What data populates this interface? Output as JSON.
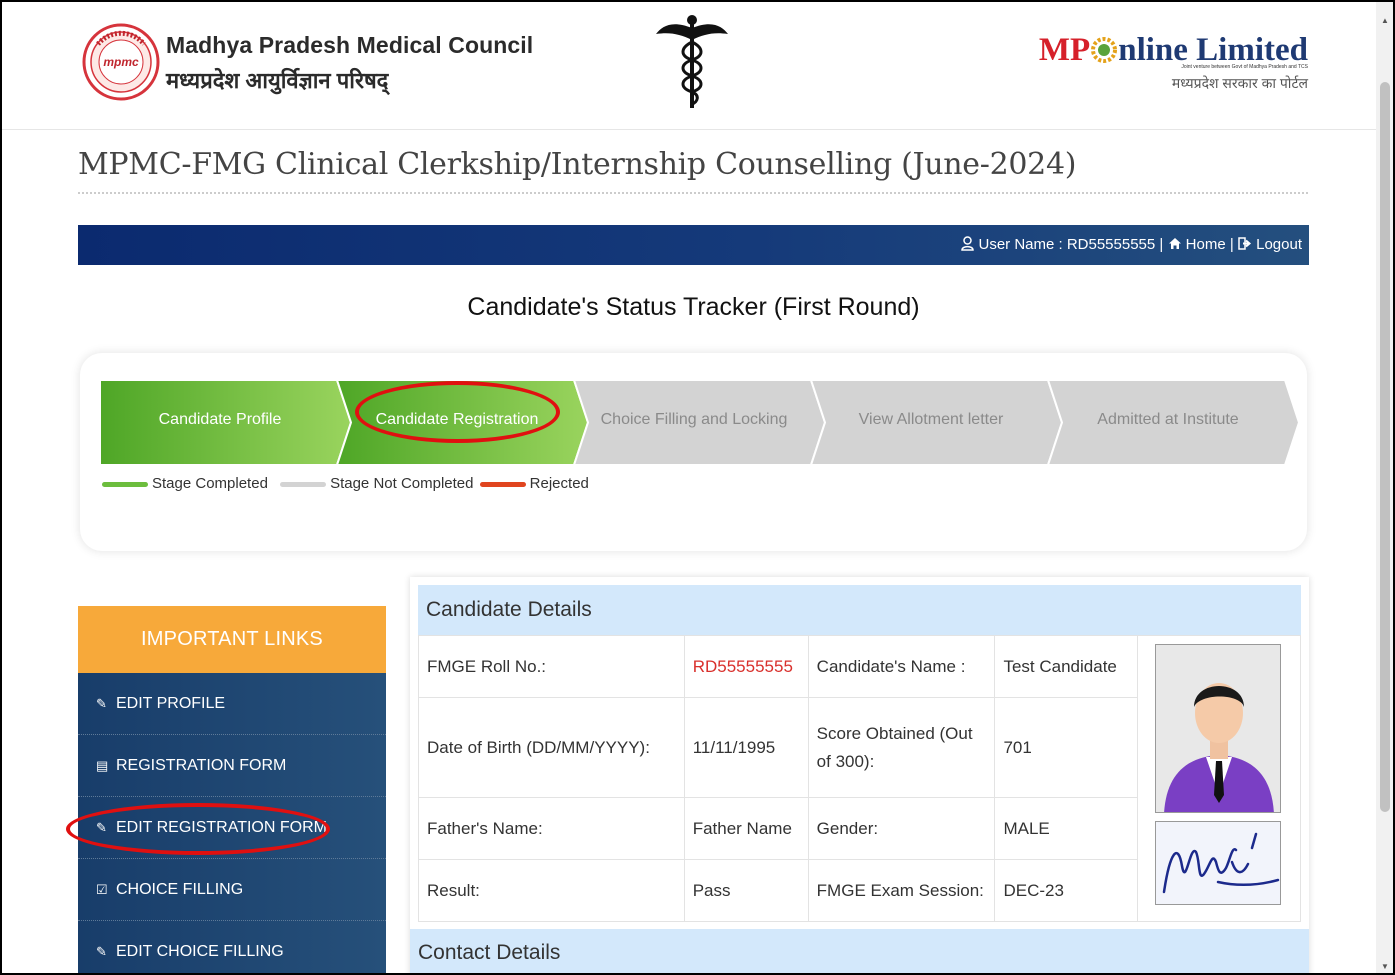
{
  "header": {
    "org_name": "Madhya Pradesh Medical Council",
    "org_name_hi": "मध्यप्रदेश आयुर्विज्ञान परिषद्",
    "logo_text": "mpmc",
    "partner": {
      "brand_prefix": "MP",
      "brand_suffix": "nline Limited",
      "tagline": "Joint venture between Govt of Madhya Pradesh and TCS",
      "tagline_hi": "मध्यप्रदेश सरकार का पोर्टल"
    }
  },
  "page_title": "MPMC-FMG Clinical Clerkship/Internship Counselling (June-2024)",
  "topbar": {
    "user_label": "User Name : RD55555555",
    "home_label": "Home",
    "logout_label": "Logout",
    "separator": "|"
  },
  "tracker": {
    "title": "Candidate's Status Tracker (First Round)",
    "steps": [
      {
        "label": "Candidate Profile",
        "status": "completed"
      },
      {
        "label": "Candidate Registration",
        "status": "completed"
      },
      {
        "label": "Choice Filling and Locking",
        "status": "not-completed"
      },
      {
        "label": "View Allotment letter",
        "status": "not-completed"
      },
      {
        "label": "Admitted at Institute",
        "status": "not-completed"
      }
    ],
    "legend": {
      "completed": "Stage Completed",
      "not_completed": "Stage Not Completed",
      "rejected": "Rejected"
    }
  },
  "sidebar": {
    "heading": "IMPORTANT LINKS",
    "items": [
      {
        "label": "EDIT PROFILE",
        "icon": "edit-icon",
        "glyph": "✎"
      },
      {
        "label": "REGISTRATION FORM",
        "icon": "id-card-icon",
        "glyph": "▤"
      },
      {
        "label": "EDIT REGISTRATION FORM",
        "icon": "edit-icon",
        "glyph": "✎"
      },
      {
        "label": "CHOICE FILLING",
        "icon": "check-square-icon",
        "glyph": "☑"
      },
      {
        "label": "EDIT CHOICE FILLING",
        "icon": "edit-icon",
        "glyph": "✎"
      }
    ]
  },
  "details": {
    "heading": "Candidate Details",
    "rows": [
      {
        "l1": "FMGE Roll No.:",
        "v1": "RD55555555",
        "l2": "Candidate's Name :",
        "v2": "Test Candidate"
      },
      {
        "l1": "Date of Birth (DD/MM/YYYY):",
        "v1": "11/11/1995",
        "l2": "Score Obtained (Out of 300):",
        "v2": "701"
      },
      {
        "l1": "Father's Name:",
        "v1": "Father Name",
        "l2": "Gender:",
        "v2": "MALE"
      },
      {
        "l1": "Result:",
        "v1": "Pass",
        "l2": "FMGE Exam Session:",
        "v2": "DEC-23"
      }
    ],
    "contact_heading": "Contact Details"
  },
  "colors": {
    "accent_orange": "#f7a93a",
    "navy": "#0b2a6f",
    "step_green": "#6cbd3d",
    "step_grey": "#d3d3d3",
    "annotation_red": "#e01010",
    "roll_red": "#d9302c"
  }
}
